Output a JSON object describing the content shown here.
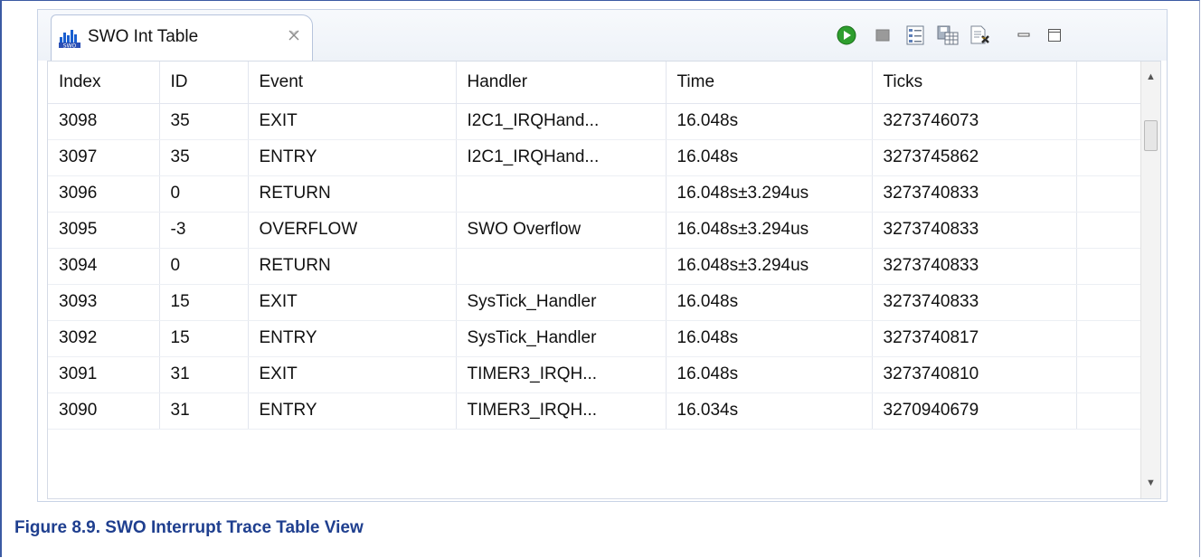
{
  "view": {
    "tab_title": "SWO Int Table",
    "tab_icon": "swo-chart-icon",
    "toolbar": [
      {
        "name": "start-trace-button",
        "icon": "play-icon"
      },
      {
        "name": "stop-trace-button",
        "icon": "stop-icon"
      },
      {
        "name": "columns-button",
        "icon": "columns-icon"
      },
      {
        "name": "save-button",
        "icon": "save-table-icon"
      },
      {
        "name": "clear-button",
        "icon": "clear-icon"
      },
      {
        "name": "minimize-button",
        "icon": "minimize-icon"
      },
      {
        "name": "maximize-button",
        "icon": "maximize-icon"
      }
    ]
  },
  "table": {
    "columns": [
      "Index",
      "ID",
      "Event",
      "Handler",
      "Time",
      "Ticks"
    ],
    "rows": [
      [
        "3098",
        "35",
        "EXIT",
        "I2C1_IRQHand...",
        "16.048s",
        "3273746073"
      ],
      [
        "3097",
        "35",
        "ENTRY",
        "I2C1_IRQHand...",
        "16.048s",
        "3273745862"
      ],
      [
        "3096",
        "0",
        "RETURN",
        "",
        "16.048s±3.294us",
        "3273740833"
      ],
      [
        "3095",
        "-3",
        "OVERFLOW",
        "SWO Overflow",
        "16.048s±3.294us",
        "3273740833"
      ],
      [
        "3094",
        "0",
        "RETURN",
        "",
        "16.048s±3.294us",
        "3273740833"
      ],
      [
        "3093",
        "15",
        "EXIT",
        "SysTick_Handler",
        "16.048s",
        "3273740833"
      ],
      [
        "3092",
        "15",
        "ENTRY",
        "SysTick_Handler",
        "16.048s",
        "3273740817"
      ],
      [
        "3091",
        "31",
        "EXIT",
        "TIMER3_IRQH...",
        "16.048s",
        "3273740810"
      ],
      [
        "3090",
        "31",
        "ENTRY",
        "TIMER3_IRQH...",
        "16.034s",
        "3270940679"
      ]
    ]
  },
  "caption": "Figure 8.9. SWO Interrupt Trace Table View",
  "colors": {
    "caption": "#1f3f8f",
    "play": "#2e9e2e",
    "frame": "#3b5aa3"
  }
}
